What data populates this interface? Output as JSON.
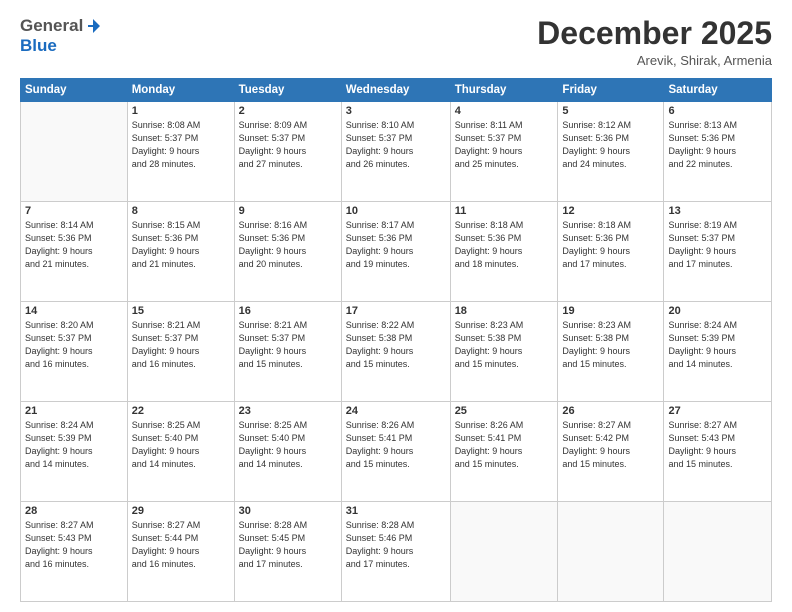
{
  "logo": {
    "general": "General",
    "blue": "Blue"
  },
  "header": {
    "month": "December 2025",
    "location": "Arevik, Shirak, Armenia"
  },
  "weekdays": [
    "Sunday",
    "Monday",
    "Tuesday",
    "Wednesday",
    "Thursday",
    "Friday",
    "Saturday"
  ],
  "weeks": [
    [
      {
        "day": "",
        "info": ""
      },
      {
        "day": "1",
        "info": "Sunrise: 8:08 AM\nSunset: 5:37 PM\nDaylight: 9 hours\nand 28 minutes."
      },
      {
        "day": "2",
        "info": "Sunrise: 8:09 AM\nSunset: 5:37 PM\nDaylight: 9 hours\nand 27 minutes."
      },
      {
        "day": "3",
        "info": "Sunrise: 8:10 AM\nSunset: 5:37 PM\nDaylight: 9 hours\nand 26 minutes."
      },
      {
        "day": "4",
        "info": "Sunrise: 8:11 AM\nSunset: 5:37 PM\nDaylight: 9 hours\nand 25 minutes."
      },
      {
        "day": "5",
        "info": "Sunrise: 8:12 AM\nSunset: 5:36 PM\nDaylight: 9 hours\nand 24 minutes."
      },
      {
        "day": "6",
        "info": "Sunrise: 8:13 AM\nSunset: 5:36 PM\nDaylight: 9 hours\nand 22 minutes."
      }
    ],
    [
      {
        "day": "7",
        "info": "Sunrise: 8:14 AM\nSunset: 5:36 PM\nDaylight: 9 hours\nand 21 minutes."
      },
      {
        "day": "8",
        "info": "Sunrise: 8:15 AM\nSunset: 5:36 PM\nDaylight: 9 hours\nand 21 minutes."
      },
      {
        "day": "9",
        "info": "Sunrise: 8:16 AM\nSunset: 5:36 PM\nDaylight: 9 hours\nand 20 minutes."
      },
      {
        "day": "10",
        "info": "Sunrise: 8:17 AM\nSunset: 5:36 PM\nDaylight: 9 hours\nand 19 minutes."
      },
      {
        "day": "11",
        "info": "Sunrise: 8:18 AM\nSunset: 5:36 PM\nDaylight: 9 hours\nand 18 minutes."
      },
      {
        "day": "12",
        "info": "Sunrise: 8:18 AM\nSunset: 5:36 PM\nDaylight: 9 hours\nand 17 minutes."
      },
      {
        "day": "13",
        "info": "Sunrise: 8:19 AM\nSunset: 5:37 PM\nDaylight: 9 hours\nand 17 minutes."
      }
    ],
    [
      {
        "day": "14",
        "info": "Sunrise: 8:20 AM\nSunset: 5:37 PM\nDaylight: 9 hours\nand 16 minutes."
      },
      {
        "day": "15",
        "info": "Sunrise: 8:21 AM\nSunset: 5:37 PM\nDaylight: 9 hours\nand 16 minutes."
      },
      {
        "day": "16",
        "info": "Sunrise: 8:21 AM\nSunset: 5:37 PM\nDaylight: 9 hours\nand 15 minutes."
      },
      {
        "day": "17",
        "info": "Sunrise: 8:22 AM\nSunset: 5:38 PM\nDaylight: 9 hours\nand 15 minutes."
      },
      {
        "day": "18",
        "info": "Sunrise: 8:23 AM\nSunset: 5:38 PM\nDaylight: 9 hours\nand 15 minutes."
      },
      {
        "day": "19",
        "info": "Sunrise: 8:23 AM\nSunset: 5:38 PM\nDaylight: 9 hours\nand 15 minutes."
      },
      {
        "day": "20",
        "info": "Sunrise: 8:24 AM\nSunset: 5:39 PM\nDaylight: 9 hours\nand 14 minutes."
      }
    ],
    [
      {
        "day": "21",
        "info": "Sunrise: 8:24 AM\nSunset: 5:39 PM\nDaylight: 9 hours\nand 14 minutes."
      },
      {
        "day": "22",
        "info": "Sunrise: 8:25 AM\nSunset: 5:40 PM\nDaylight: 9 hours\nand 14 minutes."
      },
      {
        "day": "23",
        "info": "Sunrise: 8:25 AM\nSunset: 5:40 PM\nDaylight: 9 hours\nand 14 minutes."
      },
      {
        "day": "24",
        "info": "Sunrise: 8:26 AM\nSunset: 5:41 PM\nDaylight: 9 hours\nand 15 minutes."
      },
      {
        "day": "25",
        "info": "Sunrise: 8:26 AM\nSunset: 5:41 PM\nDaylight: 9 hours\nand 15 minutes."
      },
      {
        "day": "26",
        "info": "Sunrise: 8:27 AM\nSunset: 5:42 PM\nDaylight: 9 hours\nand 15 minutes."
      },
      {
        "day": "27",
        "info": "Sunrise: 8:27 AM\nSunset: 5:43 PM\nDaylight: 9 hours\nand 15 minutes."
      }
    ],
    [
      {
        "day": "28",
        "info": "Sunrise: 8:27 AM\nSunset: 5:43 PM\nDaylight: 9 hours\nand 16 minutes."
      },
      {
        "day": "29",
        "info": "Sunrise: 8:27 AM\nSunset: 5:44 PM\nDaylight: 9 hours\nand 16 minutes."
      },
      {
        "day": "30",
        "info": "Sunrise: 8:28 AM\nSunset: 5:45 PM\nDaylight: 9 hours\nand 17 minutes."
      },
      {
        "day": "31",
        "info": "Sunrise: 8:28 AM\nSunset: 5:46 PM\nDaylight: 9 hours\nand 17 minutes."
      },
      {
        "day": "",
        "info": ""
      },
      {
        "day": "",
        "info": ""
      },
      {
        "day": "",
        "info": ""
      }
    ]
  ]
}
